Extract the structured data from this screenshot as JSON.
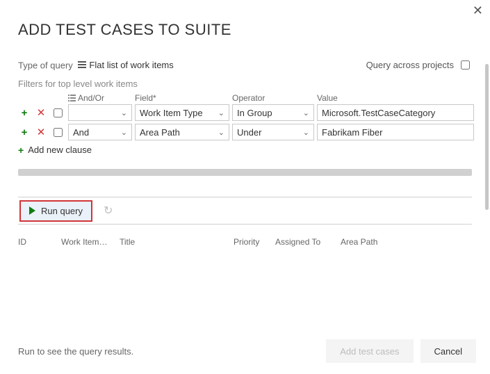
{
  "dialog": {
    "title": "ADD TEST CASES TO SUITE",
    "type_of_query_label": "Type of query",
    "query_type": "Flat list of work items",
    "query_across_label": "Query across projects",
    "filters_caption": "Filters for top level work items",
    "headers": {
      "andor": "And/Or",
      "field": "Field*",
      "operator": "Operator",
      "value": "Value"
    },
    "clauses": [
      {
        "andor": "",
        "field": "Work Item Type",
        "operator": "In Group",
        "value": "Microsoft.TestCaseCategory"
      },
      {
        "andor": "And",
        "field": "Area Path",
        "operator": "Under",
        "value": "Fabrikam Fiber"
      }
    ],
    "add_new_clause": "Add new clause",
    "run_query_label": "Run query",
    "result_columns": {
      "id": "ID",
      "wit": "Work Item…",
      "title": "Title",
      "priority": "Priority",
      "assigned": "Assigned To",
      "area": "Area Path"
    },
    "footer_msg": "Run to see the query results.",
    "buttons": {
      "add": "Add test cases",
      "cancel": "Cancel"
    }
  }
}
